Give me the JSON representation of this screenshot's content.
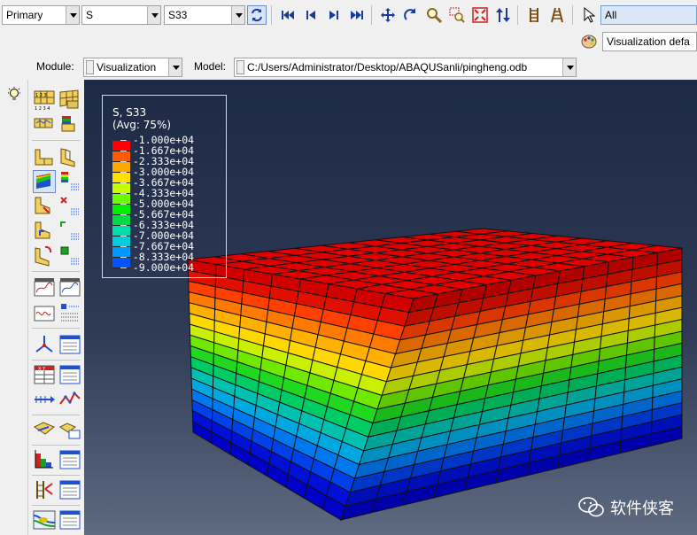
{
  "toolbar": {
    "primary_select": "Primary",
    "field_select": "S",
    "component_select": "S33",
    "selection_filter": "All",
    "render_style": "Visualization defa"
  },
  "context": {
    "module_label": "Module:",
    "module_value": "Visualization",
    "model_label": "Model:",
    "model_value": "C:/Users/Administrator/Desktop/ABAQUSanli/pingheng.odb"
  },
  "legend": {
    "title_line1": "S, S33",
    "title_line2": "(Avg: 75%)",
    "values": [
      "-1.000e+04",
      "-1.667e+04",
      "-2.333e+04",
      "-3.000e+04",
      "-3.667e+04",
      "-4.333e+04",
      "-5.000e+04",
      "-5.667e+04",
      "-6.333e+04",
      "-7.000e+04",
      "-7.667e+04",
      "-8.333e+04",
      "-9.000e+04"
    ],
    "colors": [
      "#ff0000",
      "#ff5a00",
      "#ffa800",
      "#ffe000",
      "#c8ff00",
      "#6cff00",
      "#00ee00",
      "#00dd44",
      "#00ddaa",
      "#00ccdd",
      "#0099ff",
      "#0055ff",
      "#0000ff"
    ]
  },
  "watermark": {
    "text": "软件侠客"
  }
}
